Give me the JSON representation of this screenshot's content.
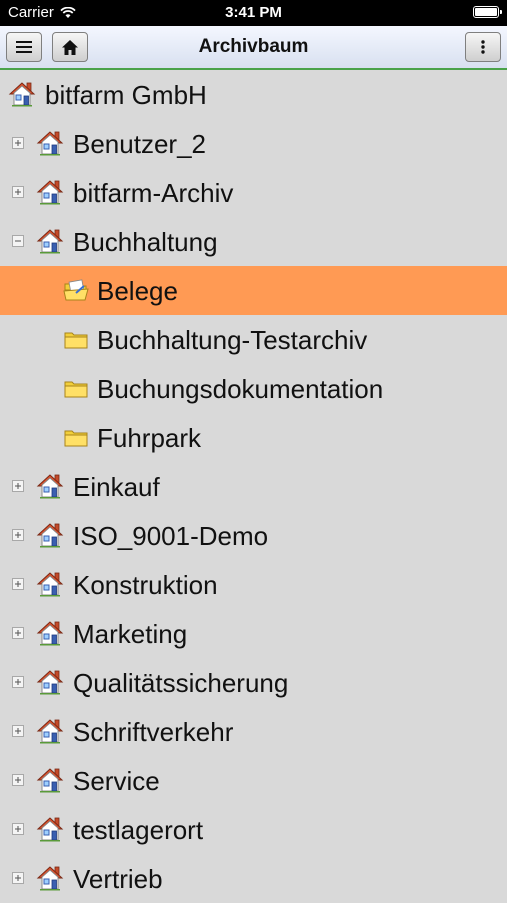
{
  "status_bar": {
    "carrier": "Carrier",
    "time": "3:41 PM"
  },
  "nav": {
    "title": "Archivbaum",
    "left_buttons": [
      "menu-icon",
      "home-icon"
    ],
    "right_button": "more-vertical-icon"
  },
  "tree": {
    "root": {
      "label": "bitfarm GmbH",
      "icon": "house-icon"
    },
    "items": [
      {
        "label": "Benutzer_2",
        "icon": "house-icon",
        "expander": "plus"
      },
      {
        "label": "bitfarm-Archiv",
        "icon": "house-icon",
        "expander": "plus"
      },
      {
        "label": "Buchhaltung",
        "icon": "house-icon",
        "expander": "minus"
      },
      {
        "label": "Belege",
        "icon": "open-folder-icon",
        "selected": true
      },
      {
        "label": "Buchhaltung-Testarchiv",
        "icon": "folder-icon"
      },
      {
        "label": "Buchungsdokumentation",
        "icon": "folder-icon"
      },
      {
        "label": "Fuhrpark",
        "icon": "folder-icon"
      },
      {
        "label": "Einkauf",
        "icon": "house-icon",
        "expander": "plus"
      },
      {
        "label": "ISO_9001-Demo",
        "icon": "house-icon",
        "expander": "plus"
      },
      {
        "label": "Konstruktion",
        "icon": "house-icon",
        "expander": "plus"
      },
      {
        "label": "Marketing",
        "icon": "house-icon",
        "expander": "plus"
      },
      {
        "label": "Qualitätssicherung",
        "icon": "house-icon",
        "expander": "plus"
      },
      {
        "label": "Schriftverkehr",
        "icon": "house-icon",
        "expander": "plus"
      },
      {
        "label": "Service",
        "icon": "house-icon",
        "expander": "plus"
      },
      {
        "label": "testlagerort",
        "icon": "house-icon",
        "expander": "plus"
      },
      {
        "label": "Vertrieb",
        "icon": "house-icon",
        "expander": "plus"
      }
    ]
  },
  "colors": {
    "background": "#d9d9d9",
    "selected_row": "#ff9a54",
    "nav_underline": "#4aa24a",
    "house_roof": "#e0502a",
    "house_wall": "#ffffff",
    "house_door": "#3a5fb0",
    "folder": "#f2cf3a"
  }
}
